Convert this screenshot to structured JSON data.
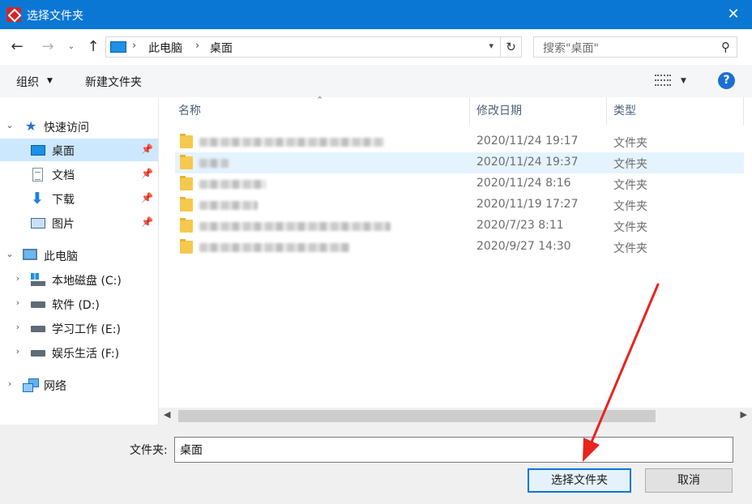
{
  "window": {
    "title": "选择文件夹",
    "close": "✕"
  },
  "address": {
    "crumbs": [
      "此电脑",
      "桌面"
    ],
    "search_placeholder": "搜索\"桌面\""
  },
  "toolbar": {
    "organize": "组织",
    "new_folder": "新建文件夹",
    "help": "?"
  },
  "nav": {
    "quick_access": "快速访问",
    "quick_items": [
      "桌面",
      "文档",
      "下载",
      "图片"
    ],
    "this_pc": "此电脑",
    "drives": [
      "本地磁盘 (C:)",
      "软件 (D:)",
      "学习工作 (E:)",
      "娱乐生活 (F:)"
    ],
    "network": "网络"
  },
  "columns": {
    "name": "名称",
    "date": "修改日期",
    "type": "类型"
  },
  "files": [
    {
      "name_visible": "",
      "date": "2020/11/24 19:17",
      "type": "文件夹"
    },
    {
      "name_visible": "",
      "date": "2020/11/24 19:37",
      "type": "文件夹"
    },
    {
      "name_visible": "",
      "date": "2020/11/24 8:16",
      "type": "文件夹"
    },
    {
      "name_visible": "",
      "date": "2020/11/19 17:27",
      "type": "文件夹"
    },
    {
      "name_visible": "",
      "date": "2020/7/23 8:11",
      "type": "文件夹"
    },
    {
      "name_visible": "",
      "date": "2020/9/27 14:30",
      "type": "文件夹"
    }
  ],
  "footer": {
    "folder_label": "文件夹:",
    "folder_value": "桌面",
    "select_button": "选择文件夹",
    "cancel_button": "取消"
  },
  "colors": {
    "titlebar": "#0a77d4",
    "selection": "#cce8ff",
    "annotation": "#e8241c"
  }
}
